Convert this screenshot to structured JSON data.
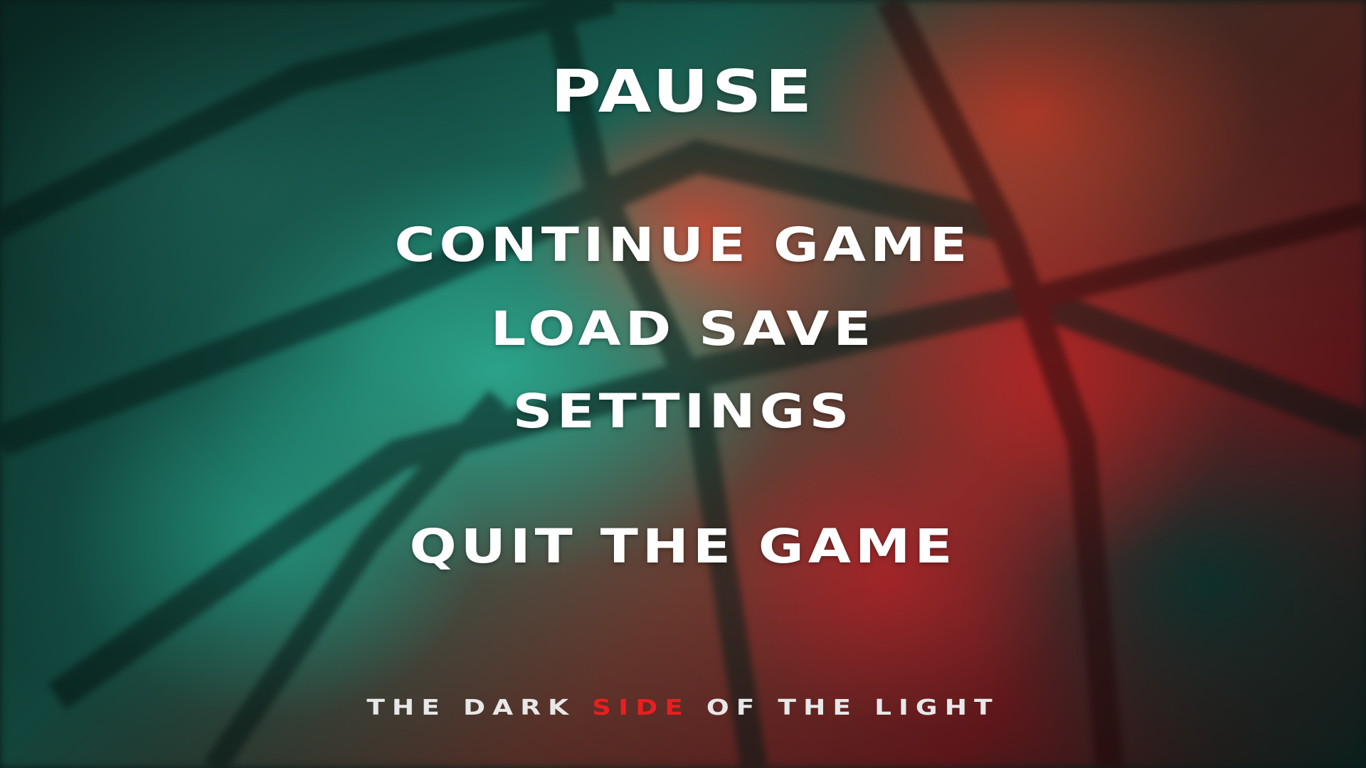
{
  "menu": {
    "title": "PAUSE",
    "items": {
      "continue": "CONTINUE GAME",
      "load": "LOAD SAVE",
      "settings": "SETTINGS",
      "quit": "QUIT THE GAME"
    }
  },
  "tagline": {
    "before": "THE DARK ",
    "accent": "SIDE",
    "after": " OF THE LIGHT"
  },
  "colors": {
    "text": "#ffffff",
    "tagline_accent": "#e81f1f",
    "background_teal": "#1f6b5c",
    "background_red": "#b52626"
  }
}
